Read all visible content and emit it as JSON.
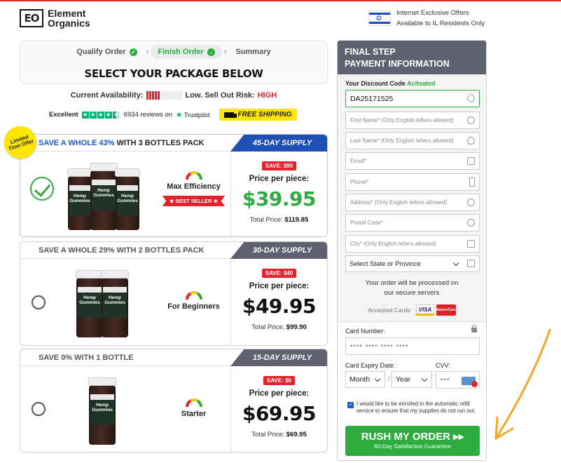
{
  "header": {
    "logo_mark": "EO",
    "logo_line1": "Element",
    "logo_line2": "Organics",
    "offer_line1": "Internet Exclusive Offers",
    "offer_line2": "Available to IL Residents Only"
  },
  "steps": [
    {
      "label": "Qualify Order",
      "state": "done"
    },
    {
      "label": "Finish Order",
      "state": "active"
    },
    {
      "label": "Summary",
      "state": "pending"
    }
  ],
  "main_title": "SELECT YOUR PACKAGE BELOW",
  "availability": {
    "label": "Current Availability:",
    "risk_label": "Low. Sell Out Risk:",
    "risk_value": "HIGH",
    "stock_level": 0.4
  },
  "trust": {
    "rating_word": "Excellent",
    "reviews_text": "6934 reviews on",
    "brand": "Trustpilot",
    "stars": 4.5,
    "shipping": "FREE SHIPPING"
  },
  "limited_badge": "Limited Time Offer",
  "packages": [
    {
      "save_prefix": "SAVE A WHOLE 43%",
      "save_suffix": "WITH 3 BOTTLES PACK",
      "supply": "45-DAY SUPPLY",
      "tag": "Max Efficiency",
      "ribbon": "BEST SELLER",
      "save_badge": "SAVE: $90",
      "price_label": "Price per piece:",
      "price": "$39.95",
      "total_label": "Total Price:",
      "total": "$119.85",
      "selected": true
    },
    {
      "save_prefix": "SAVE A WHOLE 29% WITH 2 BOTTLES PACK",
      "save_suffix": "",
      "supply": "30-DAY SUPPLY",
      "tag": "For Beginners",
      "ribbon": "",
      "save_badge": "SAVE: $40",
      "price_label": "Price per piece:",
      "price": "$49.95",
      "total_label": "Total Price:",
      "total": "$99.90",
      "selected": false
    },
    {
      "save_prefix": "SAVE 0% WITH 1 BOTTLE",
      "save_suffix": "",
      "supply": "15-DAY SUPPLY",
      "tag": "Starter",
      "ribbon": "",
      "save_badge": "SAVE: $0",
      "price_label": "Price per piece:",
      "price": "$69.95",
      "total_label": "Total Price:",
      "total": "$69.95",
      "selected": false
    }
  ],
  "bottle_label": "Hemp Gummies",
  "form": {
    "head_line1": "FINAL STEP",
    "head_line2": "PAYMENT INFORMATION",
    "discount_label": "Your Discount Code",
    "discount_status": "Activated",
    "discount_code": "DA25171525",
    "first_name": "First Name* (Only English letters allowed)",
    "last_name": "Last Name* (Only English letters allowed)",
    "email": "Email*",
    "phone": "Phone*",
    "address": "Address* (Only English letters allowed)",
    "postal": "Postal Code*",
    "city": "City* (Only English letters allowed)",
    "state": "Select State or Province",
    "secure_line1": "Your order will be processed on",
    "secure_line2": "our secure servers",
    "accepted": "Accepted Cards:",
    "visa": "VISA",
    "mastercard": "MasterCard",
    "card_number_label": "Card Number:",
    "card_number_placeholder": "•••• •••• •••• ••••",
    "expiry_label": "Card Expiry Date:",
    "cvv_label": "CVV:",
    "month": "Month",
    "year": "Year",
    "slash": "/",
    "cvv_placeholder": "•••",
    "autorefill": "I would like to be enrolled in the automatic refill service to ensure that my supplies do not run out.",
    "rush_label": "RUSH MY ORDER ▸▸",
    "guarantee": "60-Day Satisfaction Guarantee"
  },
  "colors": {
    "accent_green": "#2eac3f",
    "brand_blue": "#1e4fb3",
    "alert_red": "#e2232b",
    "header_gray": "#5e6270"
  }
}
